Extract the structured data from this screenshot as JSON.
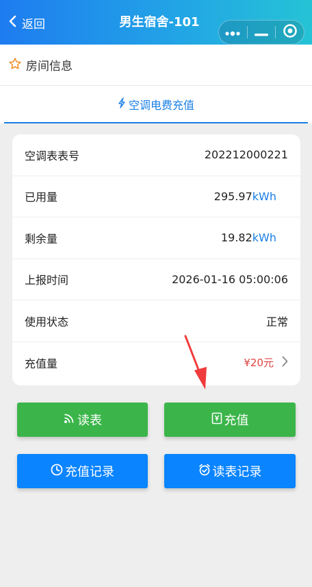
{
  "nav": {
    "back_label": "返回",
    "title": "男生宿舍-101"
  },
  "room": {
    "label": "房间信息"
  },
  "tab": {
    "label": "空调电费充值"
  },
  "info": {
    "meter_no_label": "空调表表号",
    "meter_no_value": "202212000221",
    "used_label": "已用量",
    "used_value": "295.97",
    "used_unit": "kWh",
    "remain_label": "剩余量",
    "remain_value": "19.82",
    "remain_unit": "kWh",
    "report_time_label": "上报时间",
    "report_time_value": "2026-01-16 05:00:06",
    "status_label": "使用状态",
    "status_value": "正常",
    "recharge_label": "充值量",
    "recharge_value": "¥20元"
  },
  "buttons": {
    "read_meter": "读表",
    "recharge": "充值",
    "recharge_record": "充值记录",
    "read_record": "读表记录"
  },
  "colors": {
    "nav_gradient_start": "#1e7cf0",
    "nav_gradient_end": "#25c3d6",
    "accent_blue": "#1a7fe4",
    "button_green": "#3bb54a",
    "button_blue": "#0a84ff",
    "price_red": "#e04040",
    "star_orange": "#f08a24"
  },
  "icons": {
    "back": "chevron-left-icon",
    "more": "more-dots-icon",
    "minimize": "minimize-icon",
    "close": "target-circle-icon",
    "room": "star-icon",
    "tab": "lightning-icon",
    "read_meter": "wifi-signal-icon",
    "recharge": "receipt-icon",
    "recharge_record": "clock-icon",
    "read_record": "alarm-clock-icon",
    "chevron": "chevron-right-icon"
  }
}
